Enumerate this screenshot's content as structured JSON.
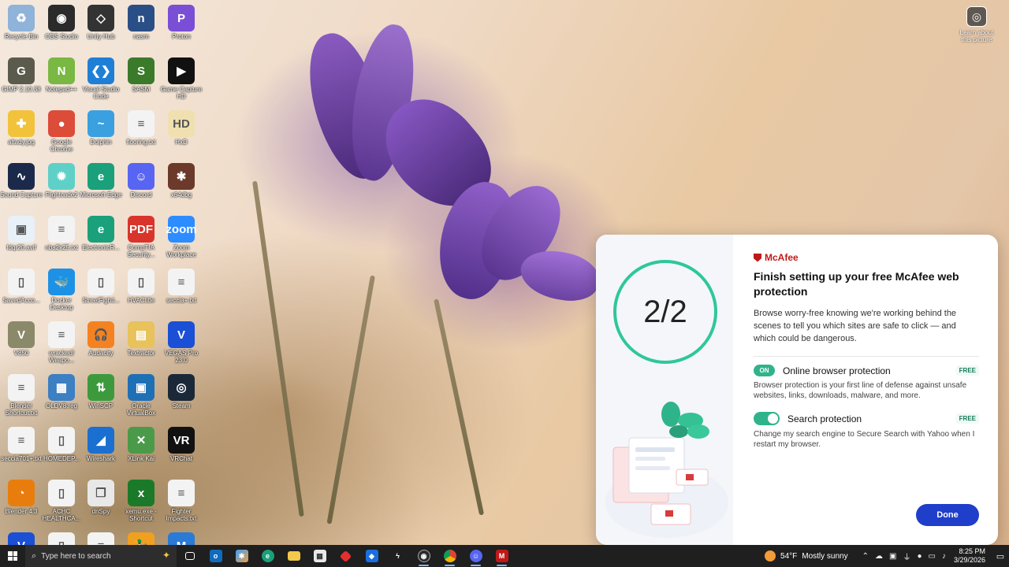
{
  "desktop": {
    "icons": [
      {
        "label": "Recycle Bin",
        "icon": "recycle-bin-icon",
        "color": "#8fb3d9",
        "glyph": "♻"
      },
      {
        "label": "OBS Studio",
        "icon": "obs-icon",
        "color": "#2b2b2b",
        "glyph": "◉"
      },
      {
        "label": "Unity Hub",
        "icon": "unity-icon",
        "color": "#333333",
        "glyph": "◇"
      },
      {
        "label": "nasm",
        "icon": "nasm-icon",
        "color": "#2a4f86",
        "glyph": "n"
      },
      {
        "label": "Proton",
        "icon": "proton-icon",
        "color": "#7a4fd6",
        "glyph": "P"
      },
      {
        "label": "GIMP 2.10.38",
        "icon": "gimp-icon",
        "color": "#5b5b4d",
        "glyph": "G"
      },
      {
        "label": "Notepad++",
        "icon": "notepadpp-icon",
        "color": "#79b843",
        "glyph": "N"
      },
      {
        "label": "Visual Studio Code",
        "icon": "vscode-icon",
        "color": "#1f7fd6",
        "glyph": "❮❯"
      },
      {
        "label": "SASM",
        "icon": "sasm-icon",
        "color": "#3a7a2a",
        "glyph": "S"
      },
      {
        "label": "Game Capture HD",
        "icon": "game-capture-icon",
        "color": "#111111",
        "glyph": "▶"
      },
      {
        "label": "altady.jpg",
        "icon": "image-file-icon",
        "color": "#f2c23a",
        "glyph": "✚"
      },
      {
        "label": "Google Chrome",
        "icon": "chrome-icon",
        "color": "#dd4b39",
        "glyph": "●"
      },
      {
        "label": "Dolphin",
        "icon": "dolphin-icon",
        "color": "#3aa0e0",
        "glyph": "~"
      },
      {
        "label": "flooring.txt",
        "icon": "text-file-icon",
        "color": "#f3f3f3",
        "glyph": "≡"
      },
      {
        "label": "HxD",
        "icon": "hxd-icon",
        "color": "#f0e0b0",
        "glyph": "HD"
      },
      {
        "label": "Sound Capture",
        "icon": "sound-capture-icon",
        "color": "#1b2a4a",
        "glyph": "∿"
      },
      {
        "label": "Flightcade2",
        "icon": "flightcade-icon",
        "color": "#5fd0c8",
        "glyph": "✹"
      },
      {
        "label": "Microsoft Edge",
        "icon": "edge-icon",
        "color": "#1aa07a",
        "glyph": "e"
      },
      {
        "label": "Discord",
        "icon": "discord-icon",
        "color": "#5865f2",
        "glyph": "☺"
      },
      {
        "label": "x64dbg",
        "icon": "x64dbg-icon",
        "color": "#6b3a2a",
        "glyph": "✱"
      },
      {
        "label": "fdqr20.avif",
        "icon": "avif-file-icon",
        "color": "#e8f0f8",
        "glyph": "▣"
      },
      {
        "label": "nba2k25.txt",
        "icon": "text-file-icon",
        "color": "#f3f3f3",
        "glyph": "≡"
      },
      {
        "label": "ElectronicR...",
        "icon": "edge-icon",
        "color": "#1aa07a",
        "glyph": "e"
      },
      {
        "label": "CompTIA Security...",
        "icon": "pdf-icon",
        "color": "#d9342b",
        "glyph": "PDF"
      },
      {
        "label": "Zoom Workplace",
        "icon": "zoom-icon",
        "color": "#2d8cff",
        "glyph": "zoom"
      },
      {
        "label": "SavedAcco...",
        "icon": "file-icon",
        "color": "#f3f3f3",
        "glyph": "▯"
      },
      {
        "label": "Docker Desktop",
        "icon": "docker-icon",
        "color": "#1d91e6",
        "glyph": "🐳"
      },
      {
        "label": "StreetFighti...",
        "icon": "file-icon",
        "color": "#f3f3f3",
        "glyph": "▯"
      },
      {
        "label": "HVACtitle",
        "icon": "file-icon",
        "color": "#f3f3f3",
        "glyph": "▯"
      },
      {
        "label": "seccia+.txt",
        "icon": "text-file-icon",
        "color": "#f3f3f3",
        "glyph": "≡"
      },
      {
        "label": "V850",
        "icon": "v850-icon",
        "color": "#8a8a6a",
        "glyph": "V"
      },
      {
        "label": "wracked! Weapo...",
        "icon": "text-file-icon",
        "color": "#f3f3f3",
        "glyph": "≡"
      },
      {
        "label": "Audacity",
        "icon": "audacity-icon",
        "color": "#f58220",
        "glyph": "🎧"
      },
      {
        "label": "Textractor",
        "icon": "folder-icon",
        "color": "#e8c25a",
        "glyph": "▤"
      },
      {
        "label": "VEGAS Pro 23.0",
        "icon": "vegas-icon",
        "color": "#1a4fd6",
        "glyph": "V"
      },
      {
        "label": "Blender Shortcut.txt",
        "icon": "text-file-icon",
        "color": "#f3f3f3",
        "glyph": "≡"
      },
      {
        "label": "OLDV8.reg",
        "icon": "reg-file-icon",
        "color": "#3c7fc2",
        "glyph": "▦"
      },
      {
        "label": "WinSCP",
        "icon": "winscp-icon",
        "color": "#3c9a3c",
        "glyph": "⇅"
      },
      {
        "label": "Oracle VirtualBox",
        "icon": "virtualbox-icon",
        "color": "#1f6fb5",
        "glyph": "▣"
      },
      {
        "label": "Steam",
        "icon": "steam-icon",
        "color": "#1b2838",
        "glyph": "◎"
      },
      {
        "label": "seccia701+.txt",
        "icon": "text-file-icon",
        "color": "#f3f3f3",
        "glyph": "≡"
      },
      {
        "label": "HOMEDEP...",
        "icon": "file-icon",
        "color": "#f3f3f3",
        "glyph": "▯"
      },
      {
        "label": "Wireshark",
        "icon": "wireshark-icon",
        "color": "#1a6fd0",
        "glyph": "◢"
      },
      {
        "label": "XLink Kai",
        "icon": "xlink-icon",
        "color": "#4a9a4a",
        "glyph": "✕"
      },
      {
        "label": "VRChat",
        "icon": "vrchat-icon",
        "color": "#111111",
        "glyph": "VR"
      },
      {
        "label": "Blender 4.3",
        "icon": "blender-icon",
        "color": "#e87d0d",
        "glyph": "◔"
      },
      {
        "label": "ACHC HEALTHCA...",
        "icon": "file-icon",
        "color": "#f3f3f3",
        "glyph": "▯"
      },
      {
        "label": "dnSpy",
        "icon": "dnspy-icon",
        "color": "#e8e8e8",
        "glyph": "❐"
      },
      {
        "label": "xemu.exe - Shortcut",
        "icon": "xemu-icon",
        "color": "#1a7a2a",
        "glyph": "x"
      },
      {
        "label": "Fighter Impacts.txt",
        "icon": "text-file-icon",
        "color": "#f3f3f3",
        "glyph": "≡"
      },
      {
        "label": "VEGAS Pro 22.0",
        "icon": "vegas-icon",
        "color": "#1a4fd6",
        "glyph": "V"
      },
      {
        "label": "Network+0...",
        "icon": "file-icon",
        "color": "#f3f3f3",
        "glyph": "▯"
      },
      {
        "label": "KAEDE.txt",
        "icon": "text-file-icon",
        "color": "#f3f3f3",
        "glyph": "≡"
      },
      {
        "label": "duckstation",
        "icon": "duckstation-icon",
        "color": "#f0a020",
        "glyph": "🦆"
      },
      {
        "label": "MAME",
        "icon": "mame-icon",
        "color": "#2a7ad6",
        "glyph": "M"
      }
    ],
    "learn_label": "Learn about this picture"
  },
  "popup": {
    "counter": "2/2",
    "brand": "McAfee",
    "title": "Finish setting up your free McAfee web protection",
    "description": "Browse worry-free knowing we're working behind the scenes to tell you which sites are safe to click — and which could be dangerous.",
    "option1": {
      "badge": "ON",
      "title": "Online browser protection",
      "tag": "FREE",
      "desc": "Browser protection is your first line of defense against unsafe websites, links, downloads, malware, and more."
    },
    "option2": {
      "title": "Search protection",
      "tag": "FREE",
      "desc": "Change my search engine to Secure Search with Yahoo when I restart my browser."
    },
    "done_label": "Done",
    "accent": "#2fc79a",
    "button_color": "#1f3ec9",
    "brand_color": "#c01818"
  },
  "taskbar": {
    "search_placeholder": "Type here to search",
    "weather_temp": "54°F",
    "weather_text": "Mostly sunny",
    "time": "8:25 PM",
    "date": "3/29/2026"
  }
}
